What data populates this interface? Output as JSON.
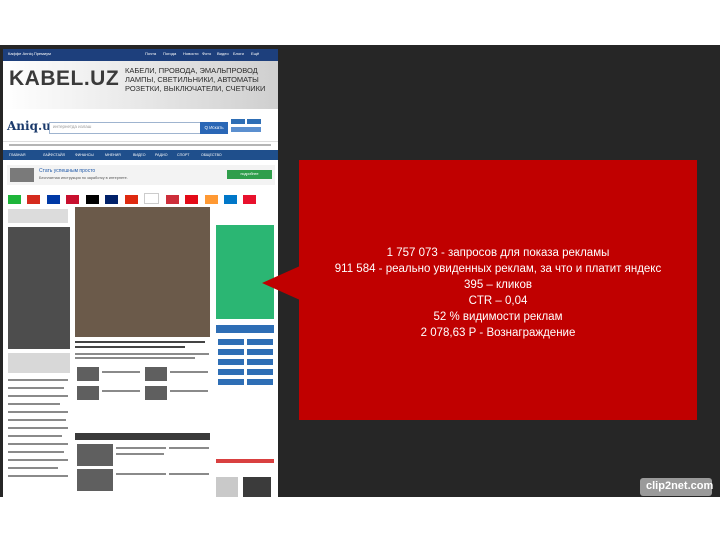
{
  "screenshot": {
    "topbar_left": "Каффе Anniq.Премиум",
    "topbar_right": [
      "Почта",
      "Погода",
      "Новости",
      "Фото",
      "Видео",
      "Блоги",
      "Ещё"
    ],
    "banner": {
      "logo": "KABEL.UZ",
      "lines": [
        "КАБЕЛИ, ПРОВОДА, ЭМАЛЬПРОВОД",
        "ЛАМПЫ, СВЕТИЛЬНИКИ, АВТОМАТЫ",
        "РОЗЕТКИ, ВЫКЛЮЧАТЕЛИ, СЧЕТЧИКИ"
      ]
    },
    "site_logo": "Aniq.uz",
    "search_placeholder": "интернетда излаш",
    "search_button": "Q Искать",
    "nav_items": [
      "ГЛАВНАЯ",
      "ЛАЙФСТАЙЛ",
      "ФИНАНСЫ",
      "МНЕНИЯ",
      "ВИДЕО",
      "РАДИО",
      "СПОРТ",
      "ОБЩЕСТВО"
    ],
    "promo": {
      "title": "Стать успешным просто",
      "text": "Бесплатная инструкция по заработку в интернете.",
      "button": "подробнее"
    }
  },
  "stats": {
    "line1": "1 757 073 - запросов для показа рекламы",
    "line2": "911 584 - реально увиденных реклам, за что и платит яндекс",
    "line3": "395 – кликов",
    "line4": "CTR – 0,04",
    "line5": "52 % видимости реклам",
    "line6": "2 078,63 Р - Вознаграждение"
  },
  "watermark": "clip2net.com",
  "colors": {
    "dark_bg": "#262626",
    "callout_red": "#c00000",
    "nav_blue": "#1f4f8c"
  }
}
